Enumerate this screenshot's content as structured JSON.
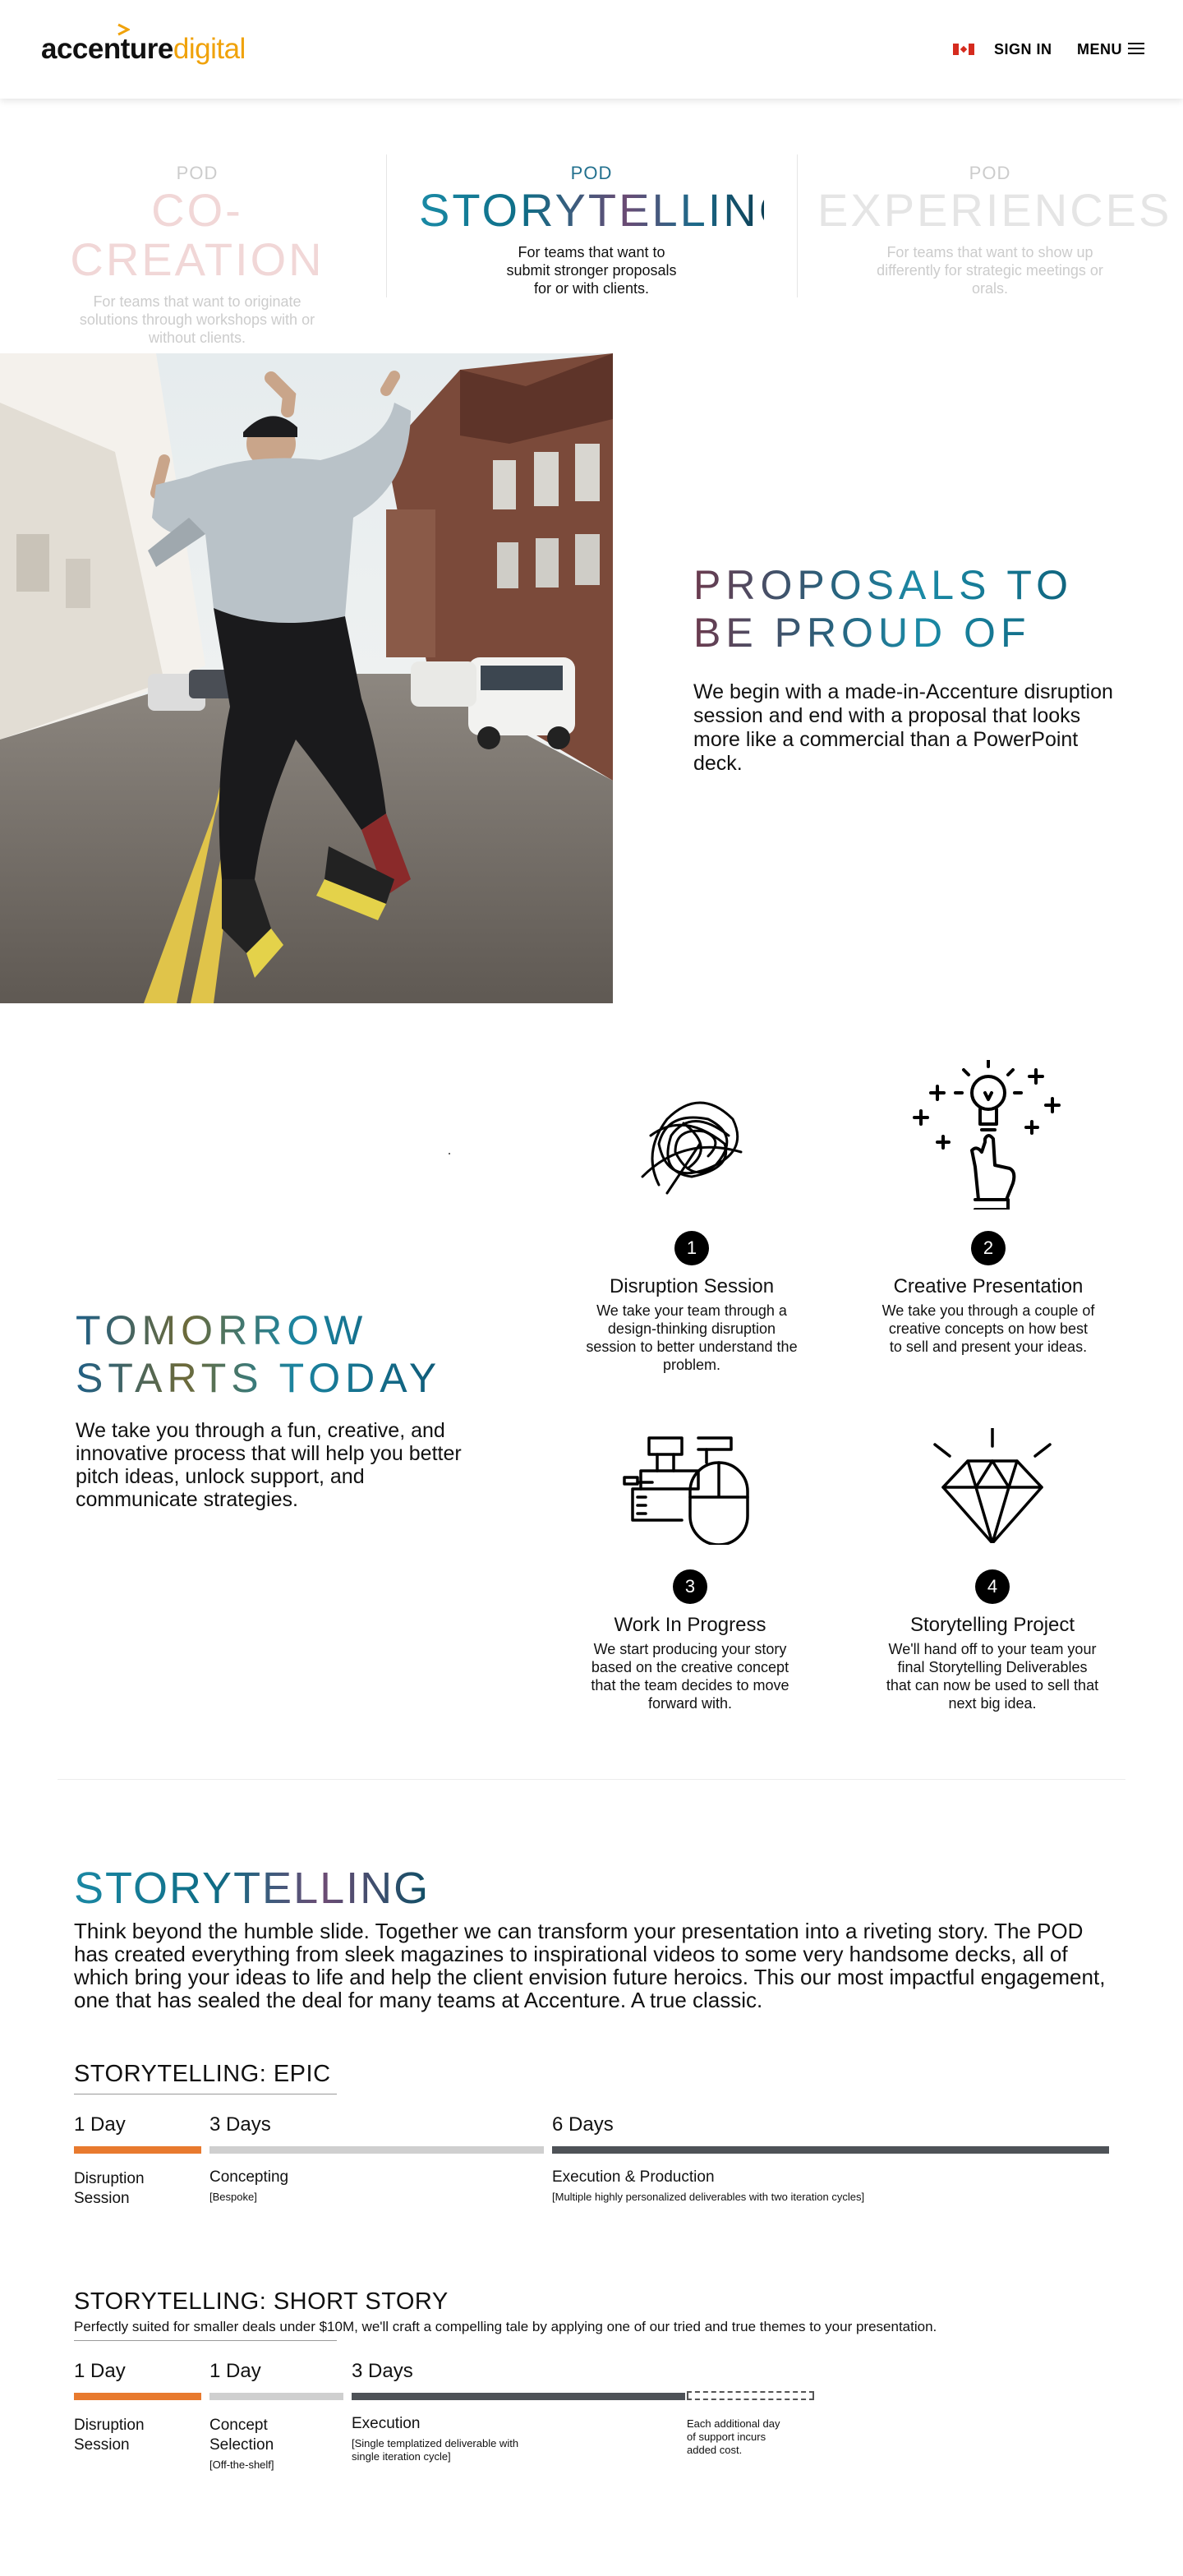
{
  "header": {
    "logo_main": "accenture",
    "logo_accent": "digital",
    "sign_in": "SIGN IN",
    "menu": "MENU",
    "colors": {
      "logo_accent": "#f0a20a",
      "flag_red": "#d52b1e"
    }
  },
  "pods": [
    {
      "label": "POD",
      "title": "CO-CREATION",
      "desc": "For teams that want to originate solutions through workshops with or without clients."
    },
    {
      "label": "POD",
      "title": "STORYTELLING",
      "desc": "For teams that want to submit stronger proposals for or with clients."
    },
    {
      "label": "POD",
      "title": "EXPERIENCES",
      "desc": "For teams that want to show up differently for strategic meetings or orals."
    }
  ],
  "hero": {
    "title_line1": "PROPOSALS TO",
    "title_line2": "BE PROUD OF",
    "text": "We begin with a made-in-Accenture disruption session and end with a proposal that looks more like a commercial than a PowerPoint deck."
  },
  "tomorrow": {
    "title_line1": "TOMORROW",
    "title_line2": "STARTS TODAY",
    "text": "We take you through a fun, creative, and innovative process that will help you better pitch ideas, unlock support, and communicate strategies."
  },
  "steps": [
    {
      "num": "1",
      "title": "Disruption Session",
      "desc": "We take your team through a design-thinking disruption session to better understand the problem.",
      "icon": "scribble-icon"
    },
    {
      "num": "2",
      "title": "Creative Presentation",
      "desc": "We take you through a couple of creative concepts on how best to sell and present your ideas.",
      "icon": "lightbulb-hand-icon"
    },
    {
      "num": "3",
      "title": "Work In Progress",
      "desc": "We start producing your story based on the creative concept that the team decides to move forward with.",
      "icon": "tools-mouse-icon"
    },
    {
      "num": "4",
      "title": "Storytelling Project",
      "desc": "We'll hand off to your team your final Storytelling Deliverables that can now be used to sell that next big idea.",
      "icon": "diamond-icon"
    }
  ],
  "storytelling": {
    "title": "STORYTELLING",
    "text": "Think beyond the humble slide. Together we can transform your presentation into a riveting story. The POD has created everything from sleek magazines to inspirational videos to some very handsome decks, all of which bring your ideas to life and help the client envision future heroics. This our most impactful engagement, one that has sealed the deal for many teams at Accenture. A true classic."
  },
  "epic": {
    "title": "STORYTELLING: EPIC",
    "phases": [
      {
        "duration": "1 Day",
        "name_line1": "Disruption",
        "name_line2": "Session",
        "note": "",
        "color": "#e87a2e"
      },
      {
        "duration": "3 Days",
        "name_line1": "Concepting",
        "name_line2": "",
        "note": "[Bespoke]",
        "color": "#cfcfcf"
      },
      {
        "duration": "6 Days",
        "name_line1": "Execution & Production",
        "name_line2": "",
        "note": "[Multiple highly personalized deliverables with two iteration cycles]",
        "color": "#4e5257"
      }
    ]
  },
  "short_story": {
    "title": "STORYTELLING: SHORT STORY",
    "subtitle": "Perfectly suited for smaller deals under $10M, we'll craft a compelling tale by applying one of our tried and true themes to your presentation.",
    "phases": [
      {
        "duration": "1 Day",
        "name_line1": "Disruption",
        "name_line2": "Session",
        "note": "",
        "color": "#e87a2e"
      },
      {
        "duration": "1 Day",
        "name_line1": "Concept",
        "name_line2": "Selection",
        "note": "[Off-the-shelf]",
        "color": "#cfcfcf"
      },
      {
        "duration": "3 Days",
        "name_line1": "Execution",
        "name_line2": "",
        "note_line1": "[Single templatized deliverable with",
        "note_line2": "single iteration cycle]",
        "color": "#4e5257"
      }
    ],
    "extra_line1": "Each additional day",
    "extra_line2": "of support incurs",
    "extra_line3": "added cost."
  }
}
